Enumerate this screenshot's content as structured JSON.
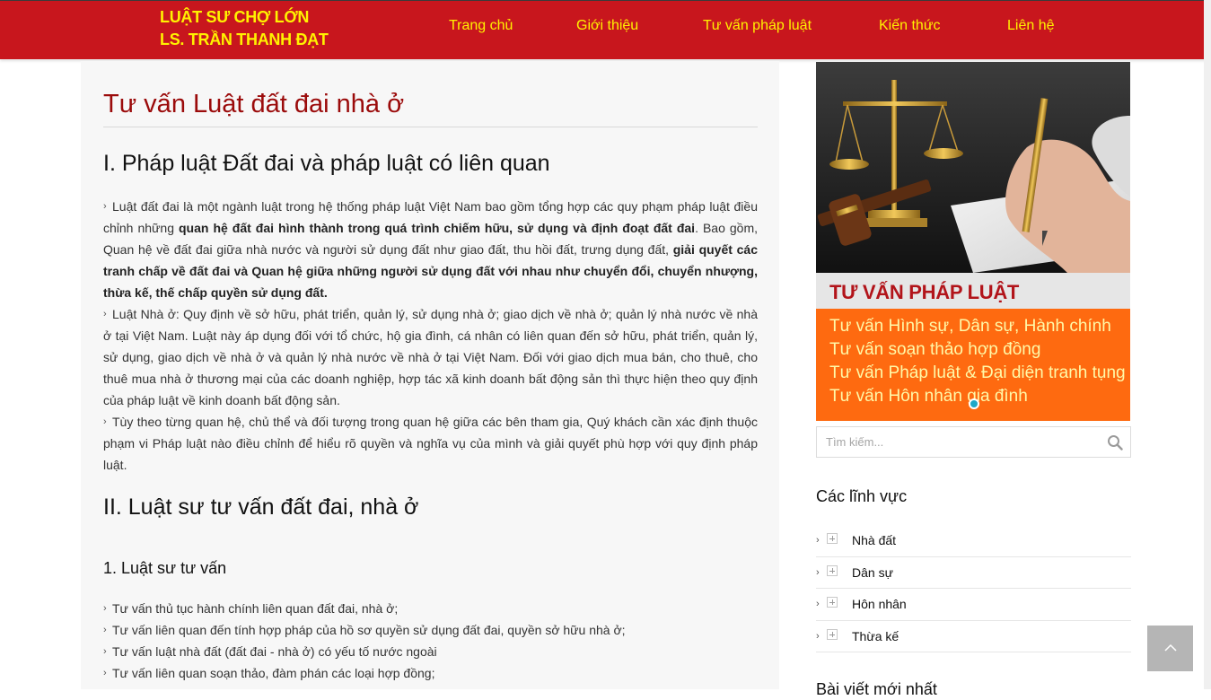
{
  "header": {
    "logo_line1": "LUẬT SƯ CHỢ LỚN",
    "logo_line2": "LS. TRẦN THANH ĐẠT",
    "nav": [
      "Trang chủ",
      "Giới thiệu",
      "Tư vấn pháp luật",
      "Kiến thức",
      "Liên hệ"
    ],
    "bg_color": "#c8161d",
    "text_color": "#fff200"
  },
  "article": {
    "title": "Tư vấn Luật đất đai nhà ở",
    "section1_heading": "I. Pháp luật Đất đai và pháp luật có liên quan",
    "p1_a": "Luật đất đai là một ngành luật trong hệ thống pháp luật Việt Nam bao gồm tổng hợp các quy phạm pháp luật điều chỉnh những ",
    "p1_b": "quan hệ đất đai hình thành trong quá trình chiếm hữu, sử dụng và định đoạt đất đai",
    "p1_c": ". Bao gồm, Quan hệ về đất đai giữa nhà nước và người sử dụng đất như giao đất, thu hồi đất, trưng dụng đất, ",
    "p1_d": "giải quyết các tranh chấp về đất đai và Quan hệ giữa những người sử dụng đất với nhau như chuyển đổi, chuyển nhượng, thừa kế, thế chấp quyền sử dụng đất.",
    "p2": "Luật Nhà ở: Quy định về sở hữu, phát triển, quản lý, sử dụng nhà ở; giao dịch về nhà ở; quản lý nhà nước về nhà ở tại Việt Nam. Luật này áp dụng đối với tổ chức, hộ gia đình, cá nhân có liên quan đến sở hữu, phát triển, quản lý, sử dụng, giao dịch về nhà ở và quản lý nhà nước về nhà ở tại Việt Nam. Đối với giao dịch mua bán, cho thuê, cho thuê mua nhà ở thương mại của các doanh nghiệp, hợp tác xã kinh doanh bất động sản thì thực hiện theo quy định của pháp luật về kinh doanh bất động sản.",
    "p3": "Tùy theo từng quan hệ, chủ thể và đối tượng trong quan hệ giữa các bên tham gia, Quý khách cần xác định thuộc phạm vi Pháp luật nào điều chỉnh để hiểu rõ quyền và nghĩa vụ của mình và giải quyết phù hợp với quy định pháp luật.",
    "section2_heading": "II. Luật sư tư vấn đất đai, nhà ở",
    "subsection_heading": "1. Luật sư tư vấn",
    "list": [
      "Tư vấn thủ tục hành chính liên quan đất đai, nhà ở;",
      "Tư vấn liên quan đến tính hợp pháp của hồ sơ quyền sử dụng đất đai, quyền sở hữu nhà ở;",
      "Tư vấn luật nhà đất (đất đai - nhà ở) có yếu tố nước ngoài",
      "Tư vấn liên quan soạn thảo, đàm phán các loại hợp đồng;"
    ],
    "title_color": "#9b0b0b"
  },
  "sidebar": {
    "banner": {
      "title": "TƯ VẤN PHÁP LUẬT",
      "lines": [
        "Tư vấn Hình sự, Dân sự, Hành chính",
        "Tư vấn soạn thảo hợp đồng",
        "Tư vấn Pháp luật & Đại diện tranh tụng",
        "Tư vấn Hôn nhân gia đình"
      ],
      "orange_color": "#fe6a10"
    },
    "search": {
      "placeholder": "Tìm kiếm...",
      "value": ""
    },
    "categories_heading": "Các lĩnh vực",
    "categories": [
      "Nhà đất",
      "Dân sự",
      "Hôn nhân",
      "Thừa kế"
    ],
    "next_heading": "Bài viết mới nhất"
  },
  "icons": {
    "search": "search-icon",
    "back_to_top": "chevron-up-icon",
    "bullet": "chevron-right-icon",
    "expand": "plus-box-icon"
  }
}
